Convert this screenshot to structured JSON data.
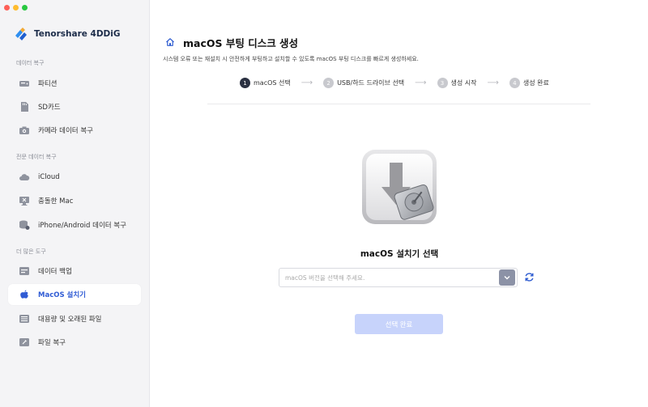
{
  "app": {
    "name": "Tenorshare 4DDiG"
  },
  "sidebar": {
    "sections": [
      {
        "title": "데이터 복구",
        "items": [
          {
            "label": "파티션",
            "icon": "partition-icon"
          },
          {
            "label": "SD카드",
            "icon": "sd-card-icon"
          },
          {
            "label": "카메라 데이터 복구",
            "icon": "camera-icon"
          }
        ]
      },
      {
        "title": "전문 데이터 복구",
        "items": [
          {
            "label": "iCloud",
            "icon": "icloud-icon"
          },
          {
            "label": "충돌한 Mac",
            "icon": "crashed-mac-icon"
          },
          {
            "label": "iPhone/Android 데이터 복구",
            "icon": "phone-recovery-icon"
          }
        ]
      },
      {
        "title": "더 많은 도구",
        "items": [
          {
            "label": "데이터 백업",
            "icon": "backup-icon"
          },
          {
            "label": "MacOS 설치기",
            "icon": "macos-installer-icon",
            "active": true
          },
          {
            "label": "대용량 및 오래된 파일",
            "icon": "large-files-icon"
          },
          {
            "label": "파일 복구",
            "icon": "file-repair-icon"
          }
        ]
      }
    ]
  },
  "main": {
    "title": "macOS 부팅 디스크 생성",
    "description": "시스템 오류 또는 재설치 시 안전하게 부팅하고 설치할 수 있도록 macOS 부팅 디스크를 빠르게 생성하세요.",
    "steps": [
      {
        "num": "1",
        "label": "macOS 선택",
        "active": true
      },
      {
        "num": "2",
        "label": "USB/하드 드라이브 선택"
      },
      {
        "num": "3",
        "label": "생성 시작"
      },
      {
        "num": "4",
        "label": "생성 완료"
      }
    ],
    "section_heading": "macOS 설치기 선택",
    "select": {
      "placeholder": "macOS 버전을 선택해 주세요."
    },
    "confirm_button": "선택 완료"
  },
  "colors": {
    "accent": "#2f5bd4",
    "button_disabled": "#c7d3fb",
    "sidebar_bg": "#f4f4f6"
  }
}
